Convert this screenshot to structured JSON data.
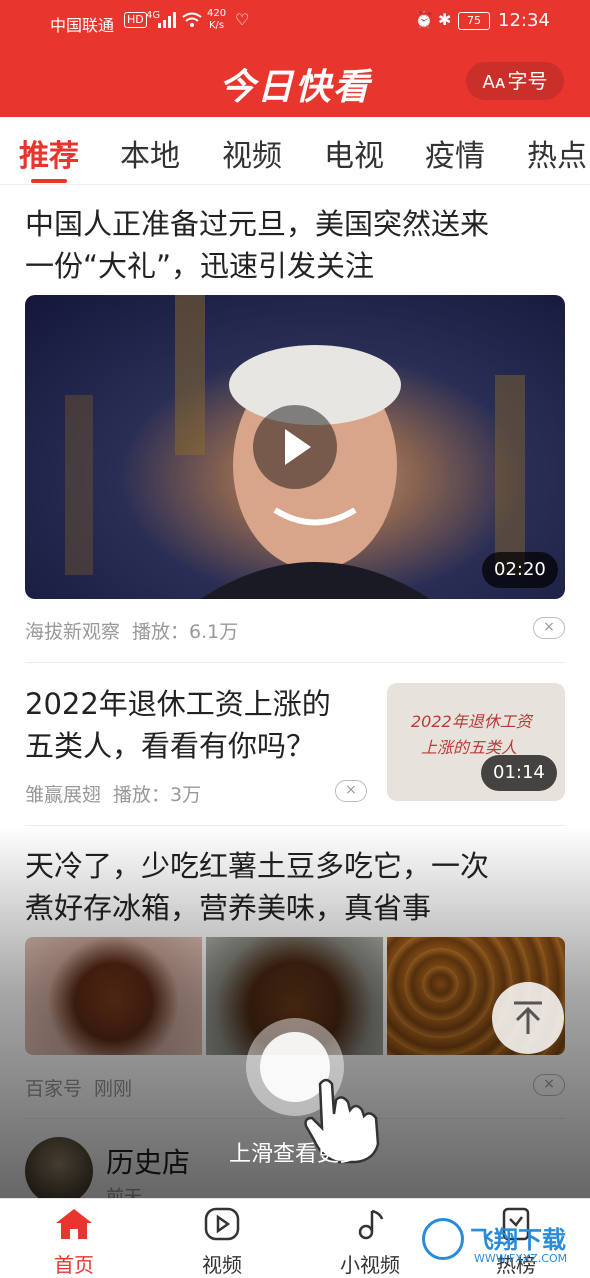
{
  "status_bar": {
    "carrier": "中国联通",
    "hd": "HD",
    "network": "4G",
    "speed_value": "420",
    "speed_unit": "K/s",
    "battery": "75",
    "time": "12:34"
  },
  "header": {
    "brand": "今日快看",
    "font_size_button": "字号",
    "font_size_icon_text": "Aᴀ",
    "color": "#e8362f"
  },
  "tabs": [
    {
      "label": "推荐",
      "active": true
    },
    {
      "label": "本地",
      "active": false
    },
    {
      "label": "视频",
      "active": false
    },
    {
      "label": "电视",
      "active": false
    },
    {
      "label": "疫情",
      "active": false
    },
    {
      "label": "热点",
      "active": false
    }
  ],
  "feed": {
    "items": [
      {
        "title_line1": "中国人正准备过元旦，美国突然送来",
        "title_line2": "一份“大礼”，迅速引发关注",
        "duration": "02:20",
        "source": "海拔新观察",
        "plays": "播放：6.1万",
        "dismiss": "×"
      },
      {
        "title_line1": "2022年退休工资上涨的",
        "title_line2": "五类人，看看有你吗？",
        "thumb_text_line1": "2022年退休工资",
        "thumb_text_line2": "上涨的五类人",
        "duration": "01:14",
        "source": "雏赢展翅",
        "plays": "播放：3万",
        "dismiss": "×"
      },
      {
        "title_line1": "天冷了，少吃红薯土豆多吃它，一次",
        "title_line2": "煮好存冰箱，营养美味，真省事",
        "source": "百家号",
        "time": "刚刚",
        "dismiss": "×"
      },
      {
        "title": "历史店",
        "sub": "前天"
      }
    ]
  },
  "overlay": {
    "hint": "上滑查看更多"
  },
  "bottom_nav": [
    {
      "label": "首页",
      "icon": "home-icon",
      "active": true
    },
    {
      "label": "视频",
      "icon": "video-play-icon",
      "active": false
    },
    {
      "label": "小视频",
      "icon": "music-note-icon",
      "active": false
    },
    {
      "label": "热榜",
      "icon": "hot-list-icon",
      "active": false
    }
  ],
  "watermark": {
    "text": "飞翔下载",
    "sub": "WWW.FXXZ.COM"
  }
}
